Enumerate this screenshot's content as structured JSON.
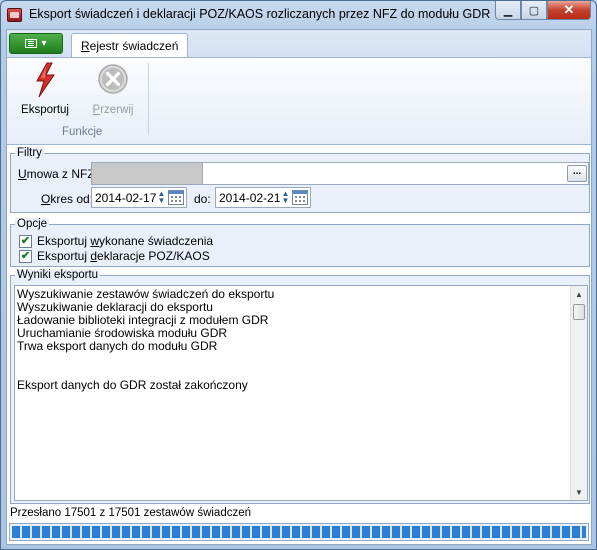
{
  "window": {
    "title": "Eksport świadczeń i deklaracji POZ/KAOS rozliczanych przez NFZ do modułu GDR",
    "min_glyph": "▁",
    "max_glyph": "▢",
    "close_glyph": "✕"
  },
  "ribbon": {
    "tab_label_underlined": "R",
    "tab_label_rest": "ejestr świadczeń",
    "buttons": {
      "export_label": "Eksportuj",
      "stop_label_underlined": "P",
      "stop_label_rest": "rzerwij"
    },
    "group_label": "Funkcje"
  },
  "filters": {
    "title": "Filtry",
    "umowa_label_underlined": "U",
    "umowa_label_rest": "mowa z NFZ:",
    "umowa_value": "",
    "dots_label": "...",
    "okres_label_underlined": "O",
    "okres_label_rest": "kres od:",
    "date_from": "2014-02-17",
    "do_label": "do:",
    "date_to": "2014-02-21"
  },
  "options": {
    "title": "Opcje",
    "export_services": {
      "checked": true,
      "label_pre": "Eksportuj ",
      "label_underlined": "w",
      "label_post": "ykonane świadczenia"
    },
    "export_declarations": {
      "checked": true,
      "label_pre": "Eksportuj ",
      "label_underlined": "d",
      "label_post": "eklaracje POZ/KAOS"
    }
  },
  "results": {
    "title": "Wyniki eksportu",
    "lines": [
      "Wyszukiwanie zestawów świadczeń do eksportu",
      "Wyszukiwanie deklaracji do eksportu",
      "Ładowanie biblioteki integracji z modułem GDR",
      "Uruchamianie środowiska modułu GDR",
      "Trwa eksport danych do modułu GDR",
      "",
      "",
      "Eksport danych do GDR został zakończony"
    ]
  },
  "status": {
    "text": "Przesłano 17501 z 17501 zestawów świadczeń",
    "progress": 1.0
  },
  "colors": {
    "accent_green": "#2e8b2a",
    "progress_blue": "#2d7fd6",
    "close_red": "#c7422d"
  }
}
